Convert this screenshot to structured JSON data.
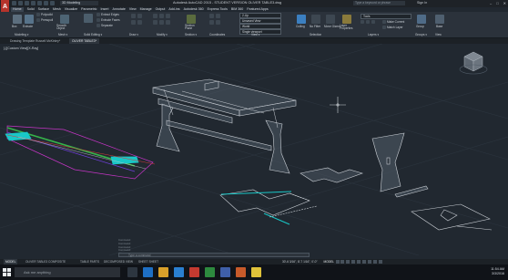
{
  "app": {
    "logo_letter": "A",
    "workspace": "3D Modeling",
    "title": "Autodesk AutoCAD 2015 - STUDENT VERSION    OLIVER TABLE3.dwg",
    "search_placeholder": "Type a keyword or phrase",
    "signin": "Sign In",
    "window_controls": [
      "–",
      "□",
      "✕"
    ]
  },
  "menu_tabs": [
    "Home",
    "Solid",
    "Surface",
    "Mesh",
    "Visualize",
    "Parametric",
    "Insert",
    "Annotate",
    "View",
    "Manage",
    "Output",
    "Add-ins",
    "Autodesk 360",
    "Express Tools",
    "BIM 360",
    "Featured Apps"
  ],
  "active_menu_tab": "Home",
  "ribbon": {
    "tools": {
      "box": "Box",
      "extrude": "Extrude",
      "smooth_object": "Smooth Object",
      "polysolid": "Polysolid",
      "presspull": "Presspull",
      "extract_edges": "Extract Edges",
      "extrude_faces": "Extrude Faces",
      "separate": "Separate",
      "section_plane": "Section Plane",
      "culling": "Culling",
      "no_filter": "No Filter",
      "move_gizmo": "Move Gizmo",
      "layer_properties": "Layer Properties",
      "make_current": "Make Current",
      "match_layer": "Match Layer",
      "group": "Group",
      "base": "Base"
    },
    "panels": {
      "modeling": "Modeling ▾",
      "mesh": "Mesh ▾",
      "solid_editing": "Solid Editing ▾",
      "draw": "Draw ▾",
      "modify": "Modify ▾",
      "section": "Section ▾",
      "coordinates": "Coordinates",
      "view": "View ▾",
      "selection": "Selection",
      "layers": "Layers ▾",
      "groups": "Groups ▾",
      "view2": "View"
    },
    "view_dropdowns": [
      "2-Up",
      "Unsaved View",
      "World",
      "Single viewport"
    ],
    "layer_dropdown": "Tools"
  },
  "doc_tabs": [
    "Drawing Template Russell McKinley*",
    "OLIVER TABLE3*"
  ],
  "active_doc_tab": "OLIVER TABLE3*",
  "viewport": {
    "label": "[-][Custom View][X-Ray]",
    "viewcube_face": "",
    "colors": {
      "background": "#212830",
      "wire": "#c9ced4",
      "panel": "#4f5a66",
      "cyan": "#19c7c7",
      "magenta": "#c535c5",
      "green": "#36b34a",
      "purple": "#6e3fd9",
      "red": "#d63a3a"
    }
  },
  "command_history": [
    "Command:",
    "Command:",
    "Command:",
    "Command:"
  ],
  "command_prompt": "Type a command",
  "layout_tabs": [
    "MODEL",
    "OLIVER TABLE3 COMPOSITE",
    "TABLE PARTS",
    "DECOMPOSED VIEW",
    "SHEET SHEET"
  ],
  "active_layout_tab": "MODEL",
  "status": {
    "coords": "30'-6 3/16\", 8'-7 1/16\", 0'-0\"",
    "mode": "MODEL"
  },
  "taskbar": {
    "search_placeholder": "Ask me anything",
    "time": "11:54 AM",
    "date": "3/3/2016"
  }
}
